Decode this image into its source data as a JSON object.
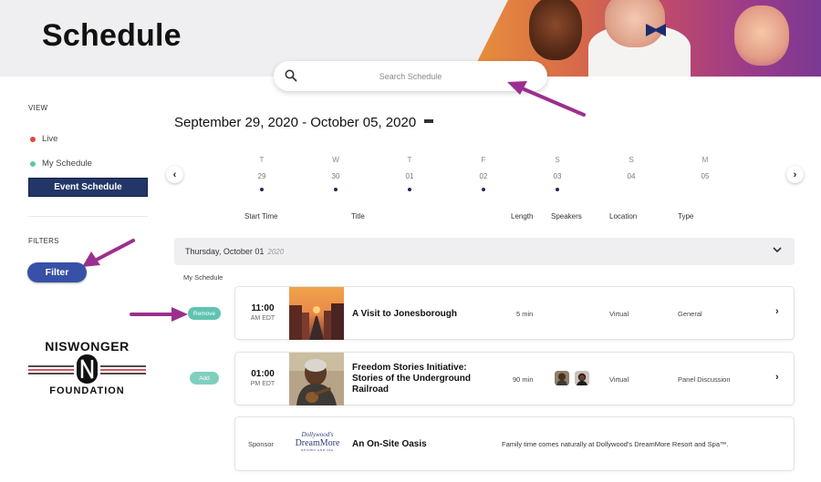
{
  "header": {
    "title": "Schedule"
  },
  "search": {
    "placeholder": "Search Schedule"
  },
  "sidebar": {
    "view_label": "VIEW",
    "view_items": [
      {
        "label": "Live",
        "dot_color": "#e0483e"
      },
      {
        "label": "My Schedule",
        "dot_color": "#5fc4b0"
      }
    ],
    "event_schedule_label": "Event Schedule",
    "filters_label": "FILTERS",
    "filter_button": "Filter",
    "logo": {
      "top": "NISWONGER",
      "bottom": "FOUNDATION"
    }
  },
  "main": {
    "date_range": "September 29, 2020 - October 05, 2020",
    "days": [
      {
        "letter": "T",
        "num": "29",
        "has_events": true
      },
      {
        "letter": "W",
        "num": "30",
        "has_events": true
      },
      {
        "letter": "T",
        "num": "01",
        "has_events": true
      },
      {
        "letter": "F",
        "num": "02",
        "has_events": true
      },
      {
        "letter": "S",
        "num": "03",
        "has_events": true
      },
      {
        "letter": "S",
        "num": "04",
        "has_events": false
      },
      {
        "letter": "M",
        "num": "05",
        "has_events": false
      }
    ],
    "columns": [
      "Start Time",
      "Title",
      "Length",
      "Speakers",
      "Location",
      "Type"
    ],
    "day_section": {
      "label": "Thursday, October 01",
      "year": "2020"
    },
    "my_schedule_label": "My Schedule",
    "sessions": [
      {
        "action": "Remove",
        "time": "11:00",
        "period": "AM EDT",
        "title": "A Visit to Jonesborough",
        "length": "5 min",
        "location": "Virtual",
        "type": "General"
      },
      {
        "action": "Add",
        "time": "01:00",
        "period": "PM EDT",
        "title_lines": [
          "Freedom Stories Initiative:",
          "Stories of the Underground",
          "Railroad"
        ],
        "length": "90 min",
        "location": "Virtual",
        "type": "Panel Discussion"
      }
    ],
    "sponsor": {
      "label": "Sponsor",
      "logo_line1": "Dollywood's",
      "logo_line2": "DreamMore",
      "logo_line3": "RESORT AND SPA",
      "title": "An On-Site Oasis",
      "description": "Family time comes naturally at Dollywood's DreamMore Resort and Spa™."
    }
  },
  "colors": {
    "primary_nav": "#233668",
    "filter_button": "#3850a7",
    "pill": "#5fc4b0",
    "annotation_arrow": "#9b2f8f"
  }
}
